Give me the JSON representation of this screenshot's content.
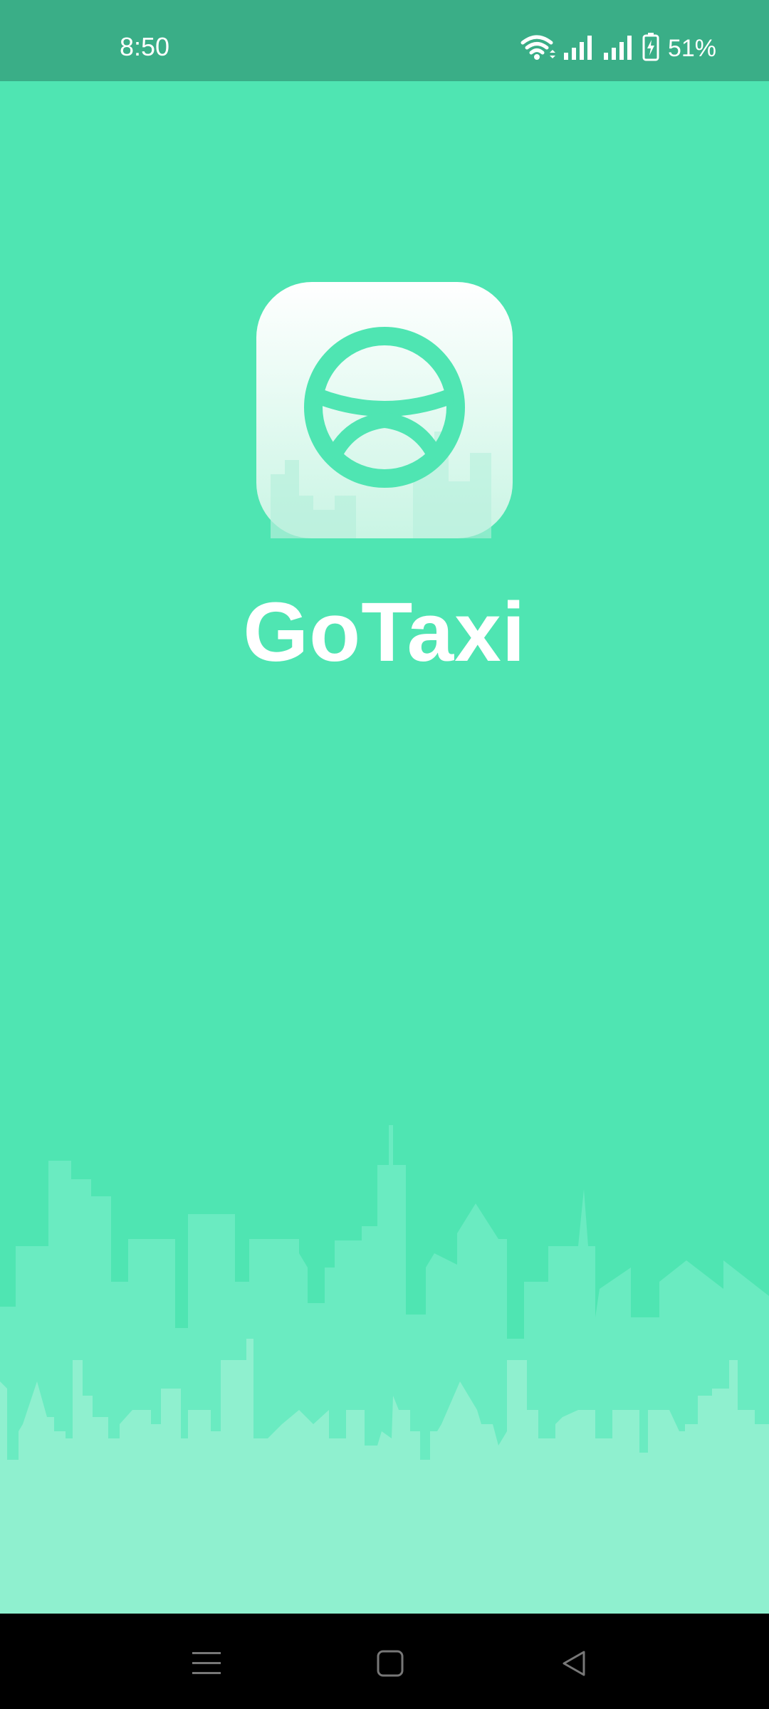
{
  "status_bar": {
    "time": "8:50",
    "battery_percent": "51%",
    "icons": [
      "wifi-icon",
      "cell-signal-icon",
      "cell-signal-icon",
      "battery-charging-icon"
    ]
  },
  "splash": {
    "app_name": "GoTaxi",
    "logo_icon": "steering-wheel-icon"
  },
  "colors": {
    "background": "#4fe5b2",
    "status_bar": "#3aae87",
    "skyline_back": "#6aebc1",
    "skyline_front": "#8ff0cf",
    "nav_bar": "#000000"
  },
  "nav_bar": {
    "buttons": [
      "menu-icon",
      "home-icon",
      "back-icon"
    ]
  }
}
